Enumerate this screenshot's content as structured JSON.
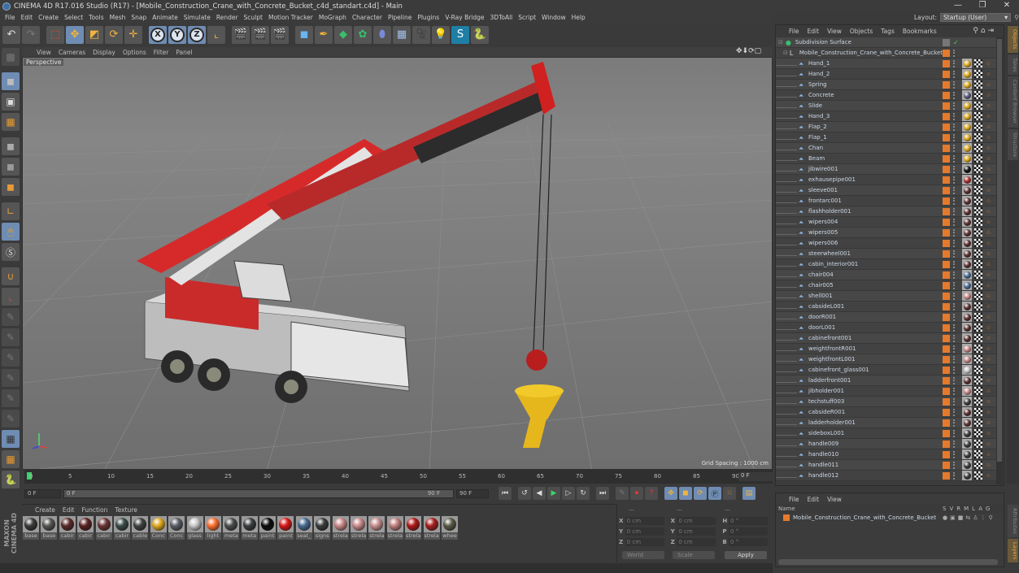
{
  "window": {
    "title": "CINEMA 4D R17.016 Studio (R17) - [Mobile_Construction_Crane_with_Concrete_Bucket_c4d_standart.c4d] - Main",
    "minimize": "—",
    "maximize": "❐",
    "close": "✕"
  },
  "menubar": [
    "File",
    "Edit",
    "Create",
    "Select",
    "Tools",
    "Mesh",
    "Snap",
    "Animate",
    "Simulate",
    "Render",
    "Sculpt",
    "Motion Tracker",
    "MoGraph",
    "Character",
    "Pipeline",
    "Plugins",
    "V-Ray Bridge",
    "3DToAll",
    "Script",
    "Window",
    "Help"
  ],
  "layout": {
    "label": "Layout:",
    "value": "Startup (User)"
  },
  "toolbar": {
    "undo": "undo-icon",
    "redo": "redo-icon",
    "axes": [
      "X",
      "Y",
      "Z"
    ]
  },
  "viewport": {
    "menu": [
      "View",
      "Cameras",
      "Display",
      "Options",
      "Filter",
      "Panel"
    ],
    "camera_label": "Perspective",
    "grid_spacing": "Grid Spacing : 1000 cm",
    "nav_icons": "✥⬇⟳▢"
  },
  "timeline": {
    "ticks": [
      "0",
      "5",
      "10",
      "15",
      "20",
      "25",
      "30",
      "35",
      "40",
      "45",
      "50",
      "55",
      "60",
      "65",
      "70",
      "75",
      "80",
      "85",
      "90"
    ],
    "current_frame_right": "0 F"
  },
  "transport": {
    "start_field": "0 F",
    "range_start": "0 F",
    "range_end": "90 F",
    "end_field": "90 F"
  },
  "materials": {
    "menu": [
      "Create",
      "Edit",
      "Function",
      "Texture"
    ],
    "items": [
      {
        "name": "base",
        "color": "#3a3a38"
      },
      {
        "name": "base",
        "color": "#555552"
      },
      {
        "name": "cabir",
        "color": "#5b2a2a"
      },
      {
        "name": "cabir",
        "color": "#5a2222"
      },
      {
        "name": "cabir",
        "color": "#6a3535"
      },
      {
        "name": "cabir",
        "color": "#3a4a48"
      },
      {
        "name": "cable",
        "color": "#3f4242"
      },
      {
        "name": "Conc",
        "color": "#e0aa20"
      },
      {
        "name": "Conc",
        "color": "#5a5e66"
      },
      {
        "name": "glass",
        "color": "#c8c8c8"
      },
      {
        "name": "light",
        "color": "#ff7030"
      },
      {
        "name": "meta",
        "color": "#4a4c4c"
      },
      {
        "name": "meta",
        "color": "#3a3e3e"
      },
      {
        "name": "paint",
        "color": "#0a0a0a"
      },
      {
        "name": "paint",
        "color": "#d81818"
      },
      {
        "name": "seat_",
        "color": "#4a6a92"
      },
      {
        "name": "signs",
        "color": "#3a3c3c"
      },
      {
        "name": "strela",
        "color": "#c88888"
      },
      {
        "name": "strela",
        "color": "#c88a8a"
      },
      {
        "name": "strela",
        "color": "#c89090"
      },
      {
        "name": "strela",
        "color": "#c08080"
      },
      {
        "name": "strela",
        "color": "#b01818"
      },
      {
        "name": "strela",
        "color": "#a82020"
      },
      {
        "name": "whee",
        "color": "#5a5a48"
      }
    ]
  },
  "coords": {
    "headers": [
      "—",
      "—",
      "—"
    ],
    "rows": [
      {
        "a": "X",
        "v1": "0 cm",
        "b": "X",
        "v2": "0 cm",
        "c": "H",
        "v3": "0 °"
      },
      {
        "a": "Y",
        "v1": "0 cm",
        "b": "Y",
        "v2": "0 cm",
        "c": "P",
        "v3": "0 °"
      },
      {
        "a": "Z",
        "v1": "0 cm",
        "b": "Z",
        "v2": "0 cm",
        "c": "B",
        "v3": "0 °"
      }
    ],
    "mode": "World",
    "scale": "Scale",
    "apply": "Apply"
  },
  "object_manager": {
    "menu": [
      "File",
      "Edit",
      "View",
      "Objects",
      "Tags",
      "Bookmarks"
    ],
    "root": "Subdivision Surface",
    "group": "Mobile_Construction_Crane_with_Concrete_Bucket",
    "objects": [
      {
        "name": "Hand_1",
        "mat": "#e0aa20"
      },
      {
        "name": "Hand_2",
        "mat": "#e0aa20"
      },
      {
        "name": "Spring",
        "mat": "#e0aa20"
      },
      {
        "name": "Concrete",
        "mat": "#5a5e7a"
      },
      {
        "name": "Slide",
        "mat": "#e0aa20"
      },
      {
        "name": "Hand_3",
        "mat": "#e0aa20"
      },
      {
        "name": "Flap_2",
        "mat": "#e0aa20"
      },
      {
        "name": "Flap_1",
        "mat": "#e0aa20"
      },
      {
        "name": "Chan",
        "mat": "#e0aa20"
      },
      {
        "name": "Beam",
        "mat": "#e0aa20"
      },
      {
        "name": "jibwire001",
        "mat": "#111111"
      },
      {
        "name": "exhausepipe001",
        "mat": "#a83030"
      },
      {
        "name": "sleeve001",
        "mat": "#5a3030"
      },
      {
        "name": "frontarc001",
        "mat": "#5a3030"
      },
      {
        "name": "flashholder001",
        "mat": "#5a3030"
      },
      {
        "name": "wipers004",
        "mat": "#5a3030"
      },
      {
        "name": "wipers005",
        "mat": "#5a3030"
      },
      {
        "name": "wipers006",
        "mat": "#5a3030"
      },
      {
        "name": "steerwheel001",
        "mat": "#5a3030"
      },
      {
        "name": "cabin_interior001",
        "mat": "#5a3030"
      },
      {
        "name": "chair004",
        "mat": "#4a6a92"
      },
      {
        "name": "chair005",
        "mat": "#4a6a92"
      },
      {
        "name": "shell001",
        "mat": "#c88888"
      },
      {
        "name": "cabsideL001",
        "mat": "#5a3030"
      },
      {
        "name": "doorR001",
        "mat": "#5a3030"
      },
      {
        "name": "doorL001",
        "mat": "#5a3030"
      },
      {
        "name": "cabinefront001",
        "mat": "#5a3030"
      },
      {
        "name": "weightfrontR001",
        "mat": "#c88888"
      },
      {
        "name": "weightfrontL001",
        "mat": "#c88888"
      },
      {
        "name": "cabinefront_glass001",
        "mat": "#c8c8c8"
      },
      {
        "name": "ladderfront001",
        "mat": "#5a3030"
      },
      {
        "name": "jibholder001",
        "mat": "#c88888"
      },
      {
        "name": "techstuff003",
        "mat": "#3a3c3c"
      },
      {
        "name": "cabsideR001",
        "mat": "#5a3030"
      },
      {
        "name": "ladderholder001",
        "mat": "#5a3030"
      },
      {
        "name": "sideboxL001",
        "mat": "#3a3c3c"
      },
      {
        "name": "handle009",
        "mat": "#3a3c3c"
      },
      {
        "name": "handle010",
        "mat": "#3a3c3c"
      },
      {
        "name": "handle011",
        "mat": "#3a3c3c"
      },
      {
        "name": "handle012",
        "mat": "#3a3c3c"
      }
    ]
  },
  "layer_manager": {
    "menu": [
      "File",
      "Edit",
      "View"
    ],
    "name_header": "Name",
    "columns": "SVRMLAG",
    "layer": "Mobile_Construction_Crane_with_Concrete_Bucket"
  },
  "side_tabs": [
    "Objects",
    "Takes",
    "Content Browser",
    "Structure"
  ],
  "side_tabs_bottom": [
    "Attributes",
    "Layers"
  ],
  "colors": {
    "accent": "#6f8cb3",
    "layer": "#e57a2c",
    "frame_marker": "#3ed06a"
  }
}
